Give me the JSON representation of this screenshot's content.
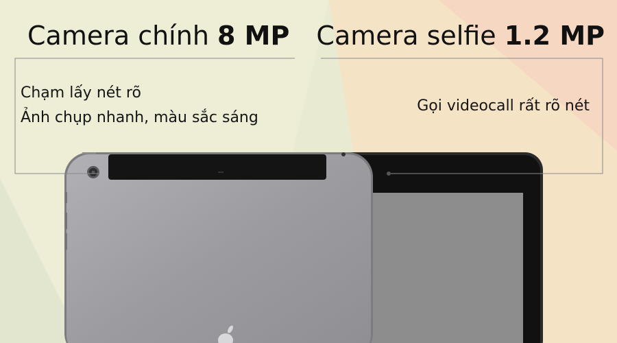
{
  "left_panel": {
    "title": "Camera chính",
    "title_value": "8 MP",
    "notes": [
      "Chạm lấy nét rõ",
      "Ảnh chụp nhanh, màu sắc sáng"
    ]
  },
  "right_panel": {
    "title": "Camera selfie",
    "title_value": "1.2 MP",
    "notes": [
      "Gọi videocall rất rõ nét"
    ]
  },
  "colors": {
    "background_warm": "#f6dcc0",
    "background_light": "#efecd6",
    "tablet_back": "#9a9a9f",
    "tablet_bezel": "#1a1a1a"
  },
  "icons": {
    "rear_camera": "rear-camera-icon",
    "front_camera": "front-camera-icon",
    "logo": "apple-logo-icon"
  }
}
